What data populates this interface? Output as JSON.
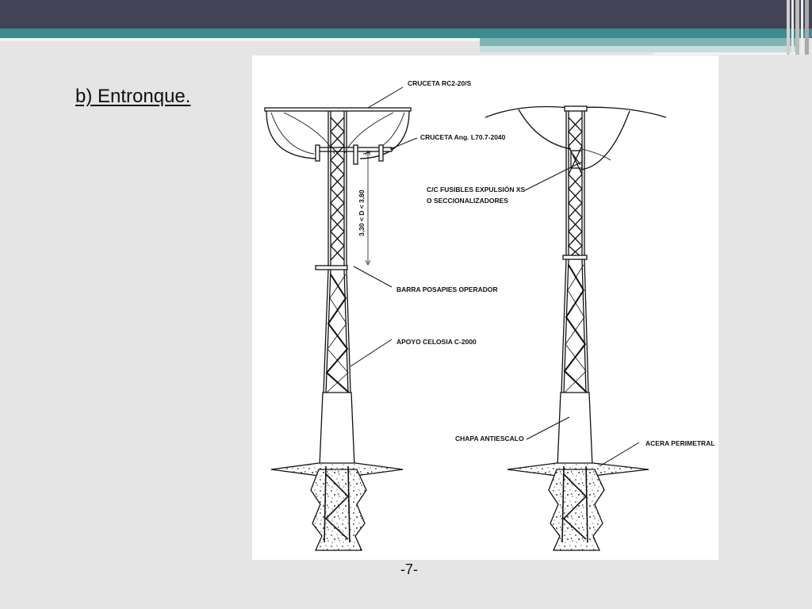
{
  "slide": {
    "title": "b) Entronque.",
    "page_number": "-7-"
  },
  "diagram": {
    "labels": {
      "cruceta_rc2": "CRUCETA RC2-20/S",
      "cruceta_ang": "CRUCETA Ang. L70.7-2040",
      "fusibles_1": "C/C FUSIBLES EXPULSIÓN XS",
      "fusibles_2": "O SECCIONALIZADORES",
      "barra": "BARRA POSAPIES OPERADOR",
      "apoyo": "APOYO CELOSIA C-2000",
      "chapa": "CHAPA ANTIESCALO",
      "acera": "ACERA PERIMETRAL",
      "dimension": "3,30 < D < 3,80"
    }
  },
  "colors": {
    "top_band": "#434358",
    "teal_band": "#3d8b8c",
    "background": "#e5e5e5"
  }
}
